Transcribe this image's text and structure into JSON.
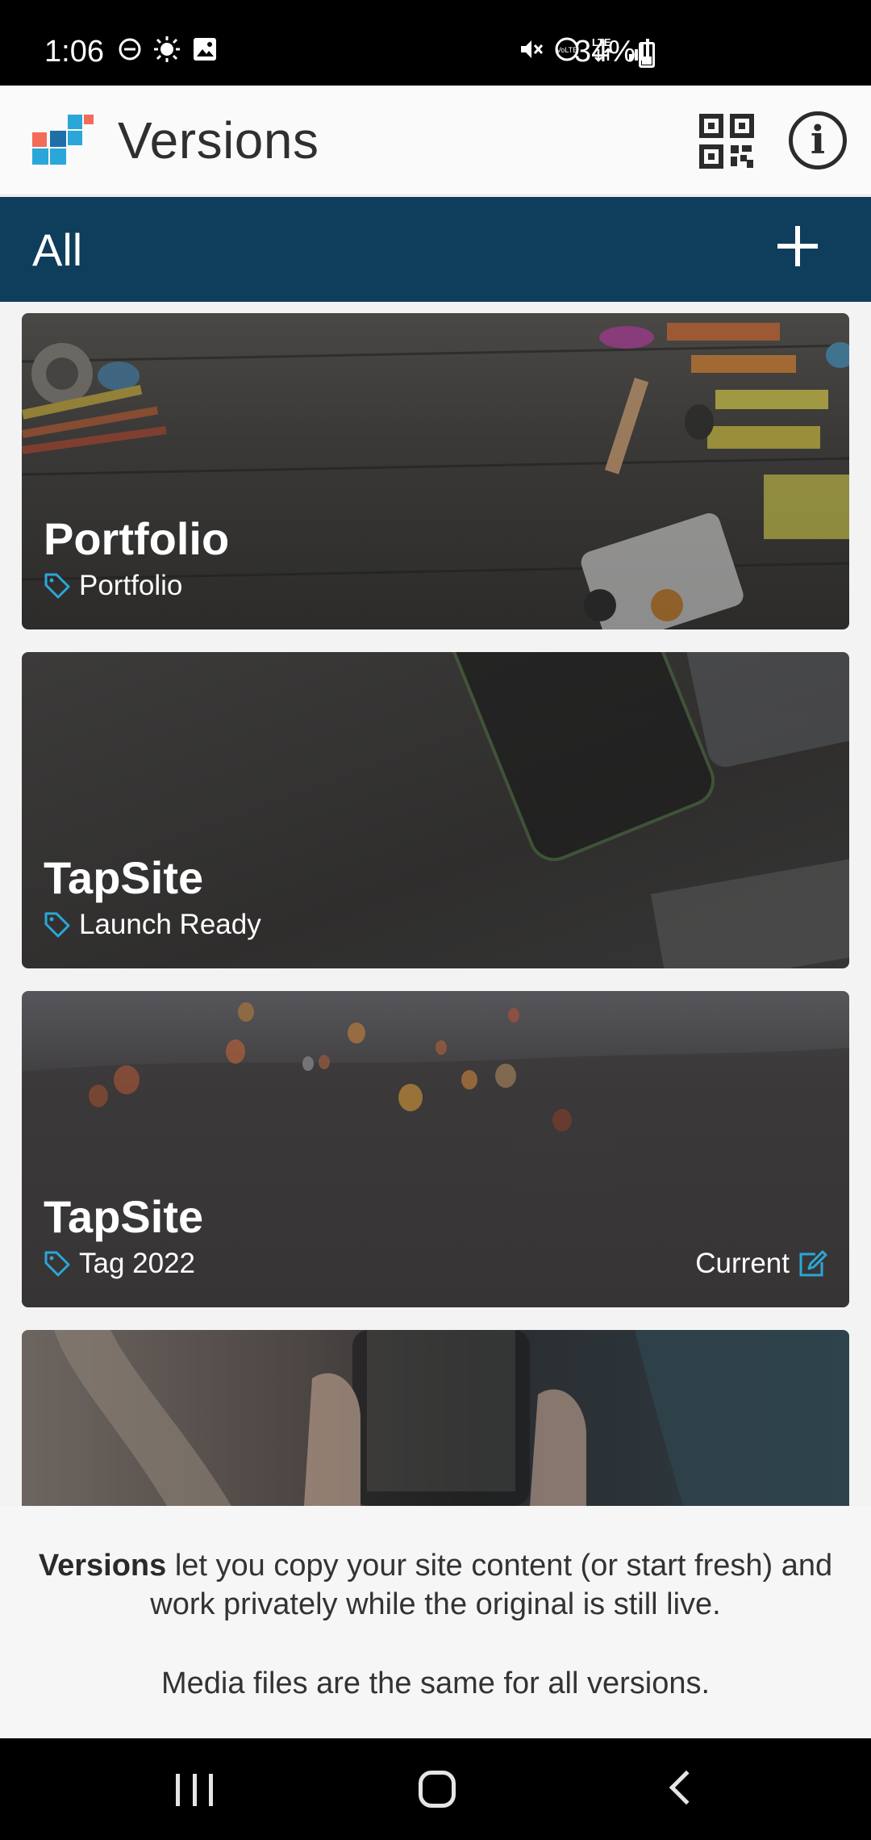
{
  "status_bar": {
    "time": "1:06",
    "battery": "34%",
    "icons": [
      "do-not-disturb-icon",
      "brightness-icon",
      "gallery-icon",
      "mute-icon",
      "volte-icon",
      "lte-icon",
      "signal-icon",
      "battery-icon"
    ]
  },
  "app_bar": {
    "title": "Versions",
    "logo_colors": [
      "#2aa7d8",
      "#f36b5a",
      "#1e6fa8"
    ],
    "actions": [
      "qr-code-icon",
      "info-icon"
    ]
  },
  "filter_bar": {
    "label": "All",
    "add_icon": "plus-icon",
    "background": "#0f3d5c"
  },
  "versions": [
    {
      "title": "Portfolio",
      "tag": "Portfolio",
      "current": ""
    },
    {
      "title": "TapSite",
      "tag": "Launch Ready",
      "current": ""
    },
    {
      "title": "TapSite",
      "tag": "Tag 2022",
      "current": "Current"
    },
    {
      "title": "",
      "tag": "",
      "current": ""
    }
  ],
  "info": {
    "bold": "Versions",
    "line1_rest": " let you copy your site content (or start fresh) and work privately while the original is still live.",
    "line2": "Media files are the same for all versions."
  },
  "accent_color": "#2aa7d8"
}
